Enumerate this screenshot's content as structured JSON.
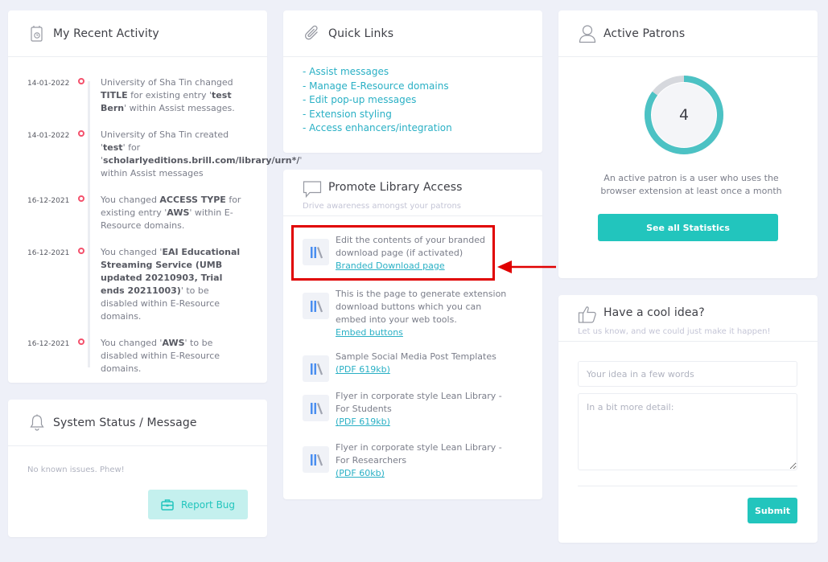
{
  "recent_activity": {
    "title": "My Recent Activity",
    "items": [
      {
        "date": "14-01-2022",
        "segments": [
          {
            "t": "University of Sha Tin changed ",
            "b": false
          },
          {
            "t": "TITLE",
            "b": true
          },
          {
            "t": " for existing entry '",
            "b": false
          },
          {
            "t": "test Bern",
            "b": true
          },
          {
            "t": "' within Assist messages.",
            "b": false
          }
        ]
      },
      {
        "date": "14-01-2022",
        "segments": [
          {
            "t": "University of Sha Tin created '",
            "b": false
          },
          {
            "t": "test",
            "b": true
          },
          {
            "t": "' for '",
            "b": false
          },
          {
            "t": "scholarlyeditions.brill.com/library/urn*/",
            "b": true
          },
          {
            "t": "' within Assist messages",
            "b": false
          }
        ]
      },
      {
        "date": "16-12-2021",
        "segments": [
          {
            "t": "You changed ",
            "b": false
          },
          {
            "t": "ACCESS TYPE",
            "b": true
          },
          {
            "t": " for existing entry '",
            "b": false
          },
          {
            "t": "AWS",
            "b": true
          },
          {
            "t": "' within E-Resource domains.",
            "b": false
          }
        ]
      },
      {
        "date": "16-12-2021",
        "segments": [
          {
            "t": "You changed '",
            "b": false
          },
          {
            "t": "EAI Educational Streaming Service (UMB updated 20210903, Trial ends 20211003)",
            "b": true
          },
          {
            "t": "' to be disabled within E-Resource domains.",
            "b": false
          }
        ]
      },
      {
        "date": "16-12-2021",
        "segments": [
          {
            "t": "You changed '",
            "b": false
          },
          {
            "t": "AWS",
            "b": true
          },
          {
            "t": "' to be disabled within E-Resource domains.",
            "b": false
          }
        ]
      }
    ]
  },
  "system_status": {
    "title": "System Status / Message",
    "message": "No known issues. Phew!",
    "report_bug_label": "Report Bug"
  },
  "quick_links": {
    "title": "Quick Links",
    "links": [
      "- Assist messages",
      "- Manage E-Resource domains",
      "- Edit pop-up messages",
      "- Extension styling",
      "- Access enhancers/integration"
    ]
  },
  "promote": {
    "title": "Promote Library Access",
    "subtitle": "Drive awareness amongst your patrons",
    "items": [
      {
        "text": "Edit the contents of your branded download page (if activated)",
        "link": "Branded Download page"
      },
      {
        "text": "This is the page to generate extension download buttons which you can embed into your web tools.",
        "link": "Embed buttons"
      },
      {
        "text": "Sample Social Media Post Templates",
        "link": "(PDF 619kb)"
      },
      {
        "text": "Flyer in corporate style Lean Library - For Students",
        "link": "(PDF 619kb)"
      },
      {
        "text": "Flyer in corporate style Lean Library - For Researchers",
        "link": "(PDF 60kb)"
      }
    ]
  },
  "active_patrons": {
    "title": "Active Patrons",
    "count": "4",
    "ring_fill_fraction": 0.85,
    "description": "An active patron is a user who uses the browser extension at least once a month",
    "stats_button_label": "See all Statistics"
  },
  "cool_idea": {
    "title": "Have a cool idea?",
    "subtitle": "Let us know, and we could just make it happen!",
    "short_placeholder": "Your idea in a few words",
    "detail_placeholder": "In a bit more detail:",
    "submit_label": "Submit"
  },
  "colors": {
    "accent": "#22c5bd",
    "link": "#2ab0c5",
    "highlight": "#e00000",
    "timeline_dot": "#f4516c"
  }
}
